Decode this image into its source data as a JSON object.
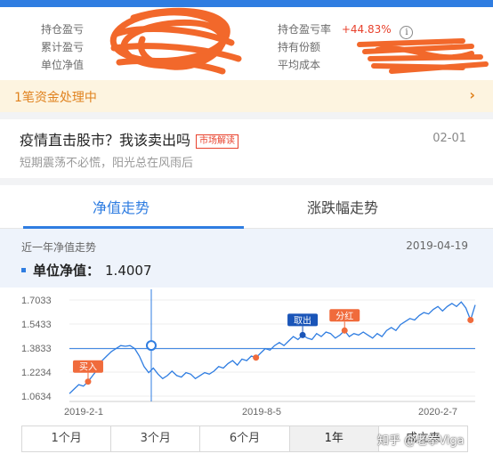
{
  "holding": {
    "left": [
      {
        "label": "持仓盈亏",
        "value": ""
      },
      {
        "label": "累计盈亏",
        "value": ""
      },
      {
        "label": "单位净值",
        "value": ""
      }
    ],
    "right": [
      {
        "label": "持仓盈亏率",
        "value": "+44.83%"
      },
      {
        "label": "持有份额",
        "value": ""
      },
      {
        "label": "平均成本",
        "value": ""
      }
    ]
  },
  "fund_banner": {
    "text": "1笔资金处理中",
    "arrow": "›"
  },
  "news": {
    "title": "疫情直击股市？我该卖出吗",
    "tag": "市场解读",
    "date": "02-01",
    "subtitle": "短期震荡不必慌，阳光总在风雨后"
  },
  "tabs": [
    {
      "label": "净值走势",
      "active": true
    },
    {
      "label": "涨跌幅走势",
      "active": false
    }
  ],
  "chart_header": {
    "name": "近一年净值走势",
    "date": "2019-04-19",
    "nav_label": "单位净值：",
    "nav_value": "1.4007"
  },
  "chart_data": {
    "type": "line",
    "y_ticks": [
      "1.7033",
      "1.5433",
      "1.3833",
      "1.2234",
      "1.0634"
    ],
    "ylim": [
      1.0634,
      1.7033
    ],
    "x_ticks": [
      "2019-2-1",
      "2019-8-5",
      "2020-2-7"
    ],
    "reference_line": 1.38,
    "crosshair_date": "2019-04-19",
    "crosshair_value": 1.4007,
    "series": [
      {
        "values": [
          1.08,
          1.11,
          1.14,
          1.13,
          1.16,
          1.2,
          1.24,
          1.3,
          1.33,
          1.36,
          1.38,
          1.4,
          1.395,
          1.4,
          1.38,
          1.33,
          1.26,
          1.22,
          1.25,
          1.21,
          1.18,
          1.2,
          1.23,
          1.2,
          1.19,
          1.22,
          1.21,
          1.18,
          1.2,
          1.22,
          1.21,
          1.23,
          1.26,
          1.25,
          1.28,
          1.3,
          1.27,
          1.31,
          1.3,
          1.33,
          1.32,
          1.35,
          1.38,
          1.37,
          1.4,
          1.42,
          1.4,
          1.43,
          1.46,
          1.44,
          1.47,
          1.45,
          1.44,
          1.48,
          1.46,
          1.49,
          1.48,
          1.45,
          1.47,
          1.5,
          1.46,
          1.48,
          1.47,
          1.49,
          1.47,
          1.45,
          1.48,
          1.46,
          1.5,
          1.52,
          1.5,
          1.54,
          1.56,
          1.58,
          1.57,
          1.6,
          1.62,
          1.61,
          1.64,
          1.66,
          1.63,
          1.66,
          1.68,
          1.66,
          1.69,
          1.65,
          1.57,
          1.67
        ]
      }
    ],
    "markers": [
      {
        "label": "买入",
        "index": 4,
        "value": 1.16
      },
      {
        "label": "",
        "index": 40,
        "value": 1.32
      },
      {
        "label": "取出",
        "index": 50,
        "value": 1.47
      },
      {
        "label": "分红",
        "index": 59,
        "value": 1.5
      },
      {
        "label": "",
        "index": 86,
        "value": 1.57
      }
    ],
    "colors": {
      "line": "#2f7de1",
      "marker": "#f06b3c",
      "dark_marker": "#1a55b8",
      "reference": "#2f7de1"
    }
  },
  "range_buttons": [
    {
      "label": "1个月",
      "active": false
    },
    {
      "label": "3个月",
      "active": false
    },
    {
      "label": "6个月",
      "active": false
    },
    {
      "label": "1年",
      "active": true
    },
    {
      "label": "成立来",
      "active": false
    }
  ],
  "watermark": "知乎 @老拳Viga"
}
